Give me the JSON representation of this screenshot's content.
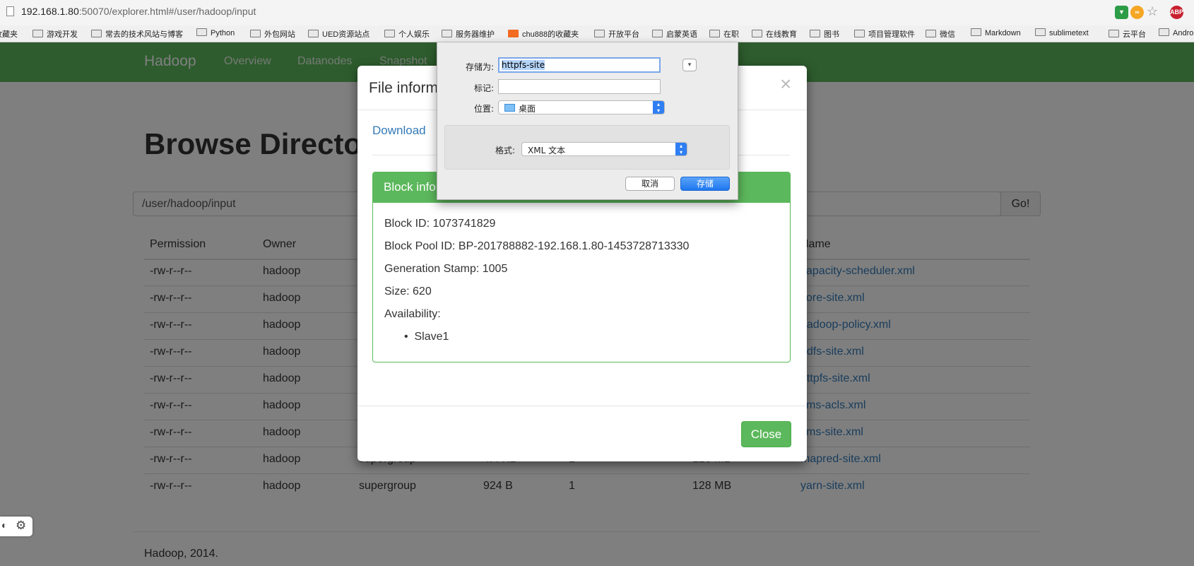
{
  "browser": {
    "url_host": "192.168.1.80",
    "url_rest": ":50070/explorer.html#/user/hadoop/input",
    "extensions": [
      "ABP"
    ],
    "bookmarks": [
      "收藏夹",
      "游戏开发",
      "常去的技术风站与博客",
      "Python",
      "外包网站",
      "UED资源站点",
      "个人娱乐",
      "服务器维护",
      "chu888的收藏夹",
      "开放平台",
      "启蒙英语",
      "在职",
      "在线教育",
      "图书",
      "项目管理软件",
      "微信",
      "Markdown",
      "sublimetext",
      "云平台",
      "Andro"
    ]
  },
  "navbar": {
    "brand": "Hadoop",
    "links": [
      "Overview",
      "Datanodes",
      "Snapshot"
    ]
  },
  "page": {
    "title": "Browse Directory",
    "path": "/user/hadoop/input",
    "go_label": "Go!",
    "headers": [
      "Permission",
      "Owner",
      "Name"
    ],
    "rows": [
      {
        "perm": "-rw-r--r--",
        "owner": "hadoop",
        "name": "capacity-scheduler.xml"
      },
      {
        "perm": "-rw-r--r--",
        "owner": "hadoop",
        "name": "core-site.xml"
      },
      {
        "perm": "-rw-r--r--",
        "owner": "hadoop",
        "name": "hadoop-policy.xml"
      },
      {
        "perm": "-rw-r--r--",
        "owner": "hadoop",
        "name": "hdfs-site.xml"
      },
      {
        "perm": "-rw-r--r--",
        "owner": "hadoop",
        "name": "httpfs-site.xml"
      },
      {
        "perm": "-rw-r--r--",
        "owner": "hadoop",
        "name": "kms-acls.xml"
      },
      {
        "perm": "-rw-r--r--",
        "owner": "hadoop",
        "name": "kms-site.xml"
      },
      {
        "perm": "-rw-r--r--",
        "owner": "hadoop",
        "group": "supergroup",
        "size": "4.4 KB",
        "replication": "1",
        "block": "128 MB",
        "name": "mapred-site.xml"
      },
      {
        "perm": "-rw-r--r--",
        "owner": "hadoop",
        "group": "supergroup",
        "size": "924 B",
        "replication": "1",
        "block": "128 MB",
        "name": "yarn-site.xml"
      }
    ],
    "footer": "Hadoop, 2014."
  },
  "modal": {
    "title": "File information",
    "download_label": "Download",
    "panel_heading": "Block information",
    "block_id": "Block ID: 1073741829",
    "block_pool_id": "Block Pool ID: BP-201788882-192.168.1.80-1453728713330",
    "generation_stamp": "Generation Stamp: 1005",
    "size": "Size: 620",
    "availability": "Availability:",
    "nodes": [
      "Slave1"
    ],
    "close_label": "Close"
  },
  "save_sheet": {
    "saveas_label": "存储为:",
    "saveas_value": "httpfs-site",
    "tags_label": "标记:",
    "where_label": "位置:",
    "where_value": "桌面",
    "format_label": "格式:",
    "format_value": "XML 文本",
    "cancel_label": "取消",
    "save_label": "存储"
  }
}
